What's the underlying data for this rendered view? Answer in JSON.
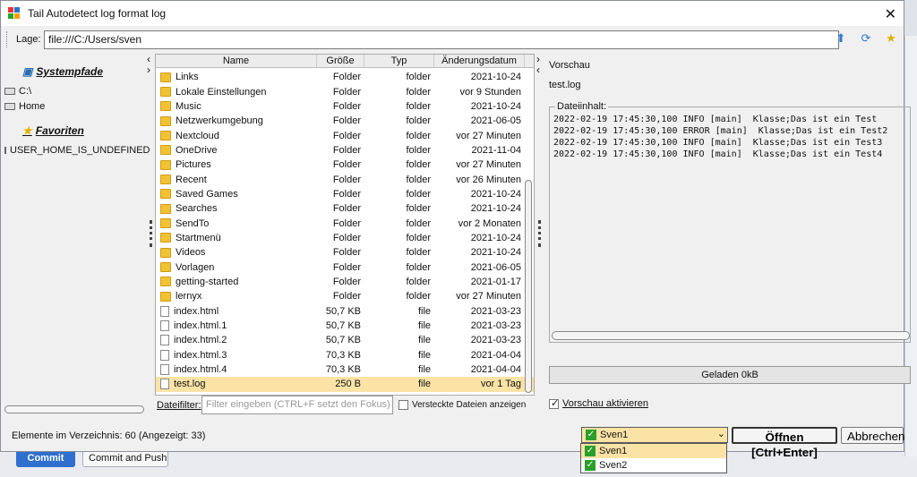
{
  "window": {
    "title": "Tail Autodetect log format log",
    "close": "✕"
  },
  "location": {
    "label": "Lage:",
    "value": "file:///C:/Users/sven"
  },
  "sidebar": {
    "system_title": "Systempfade",
    "system_items": [
      "C:\\",
      "Home"
    ],
    "favorites_title": "Favoriten",
    "favorite_items": [
      "USER_HOME_IS_UNDEFINED"
    ]
  },
  "table": {
    "columns": [
      "Name",
      "Größe",
      "Typ",
      "Änderungsdatum"
    ],
    "rows": [
      {
        "name": "Links",
        "size": "Folder",
        "type": "folder",
        "date": "2021-10-24",
        "kind": "folder"
      },
      {
        "name": "Lokale Einstellungen",
        "size": "Folder",
        "type": "folder",
        "date": "vor 9 Stunden",
        "kind": "folder"
      },
      {
        "name": "Music",
        "size": "Folder",
        "type": "folder",
        "date": "2021-10-24",
        "kind": "folder"
      },
      {
        "name": "Netzwerkumgebung",
        "size": "Folder",
        "type": "folder",
        "date": "2021-06-05",
        "kind": "folder"
      },
      {
        "name": "Nextcloud",
        "size": "Folder",
        "type": "folder",
        "date": "vor 27 Minuten",
        "kind": "folder"
      },
      {
        "name": "OneDrive",
        "size": "Folder",
        "type": "folder",
        "date": "2021-11-04",
        "kind": "folder"
      },
      {
        "name": "Pictures",
        "size": "Folder",
        "type": "folder",
        "date": "vor 27 Minuten",
        "kind": "folder"
      },
      {
        "name": "Recent",
        "size": "Folder",
        "type": "folder",
        "date": "vor 26 Minuten",
        "kind": "folder"
      },
      {
        "name": "Saved Games",
        "size": "Folder",
        "type": "folder",
        "date": "2021-10-24",
        "kind": "folder"
      },
      {
        "name": "Searches",
        "size": "Folder",
        "type": "folder",
        "date": "2021-10-24",
        "kind": "folder"
      },
      {
        "name": "SendTo",
        "size": "Folder",
        "type": "folder",
        "date": "vor 2 Monaten",
        "kind": "folder"
      },
      {
        "name": "Startmenü",
        "size": "Folder",
        "type": "folder",
        "date": "2021-10-24",
        "kind": "folder"
      },
      {
        "name": "Videos",
        "size": "Folder",
        "type": "folder",
        "date": "2021-10-24",
        "kind": "folder"
      },
      {
        "name": "Vorlagen",
        "size": "Folder",
        "type": "folder",
        "date": "2021-06-05",
        "kind": "folder"
      },
      {
        "name": "getting-started",
        "size": "Folder",
        "type": "folder",
        "date": "2021-01-17",
        "kind": "folder"
      },
      {
        "name": "lernyx",
        "size": "Folder",
        "type": "folder",
        "date": "vor 27 Minuten",
        "kind": "folder"
      },
      {
        "name": "index.html",
        "size": "50,7 KB",
        "type": "file",
        "date": "2021-03-23",
        "kind": "file"
      },
      {
        "name": "index.html.1",
        "size": "50,7 KB",
        "type": "file",
        "date": "2021-03-23",
        "kind": "file"
      },
      {
        "name": "index.html.2",
        "size": "50,7 KB",
        "type": "file",
        "date": "2021-03-23",
        "kind": "file"
      },
      {
        "name": "index.html.3",
        "size": "70,3 KB",
        "type": "file",
        "date": "2021-04-04",
        "kind": "file"
      },
      {
        "name": "index.html.4",
        "size": "70,3 KB",
        "type": "file",
        "date": "2021-04-04",
        "kind": "file"
      },
      {
        "name": "test.log",
        "size": "250 B",
        "type": "file",
        "date": "vor 1 Tag",
        "kind": "file",
        "selected": true
      }
    ]
  },
  "filter": {
    "label": "Dateifilter:",
    "placeholder": "Filter eingeben (CTRL+F setzt den Fokus)",
    "hidden_label": "Versteckte Dateien anzeigen"
  },
  "preview": {
    "title": "Vorschau",
    "file": "test.log",
    "legend": "Dateiinhalt:",
    "lines": [
      "2022-02-19 17:45:30,100 INFO [main]  Klasse;Das ist ein Test",
      "2022-02-19 17:45:30,100 ERROR [main]  Klasse;Das ist ein Test2",
      "2022-02-19 17:45:30,100 INFO [main]  Klasse;Das ist ein Test3",
      "2022-02-19 17:45:30,100 INFO [main]  Klasse;Das ist ein Test4"
    ],
    "loaded": "Geladen 0kB",
    "activate_label": "Vorschau aktivieren"
  },
  "status": "Elemente im Verzeichnis: 60 (Angezeigt: 33)",
  "combo": {
    "value": "Sven1",
    "options": [
      "Sven1",
      "Sven2"
    ]
  },
  "buttons": {
    "open": "Öffnen [Ctrl+Enter]",
    "cancel": "Abbrechen"
  },
  "background": {
    "commit": "Commit",
    "commit_push": "Commit and Push"
  }
}
